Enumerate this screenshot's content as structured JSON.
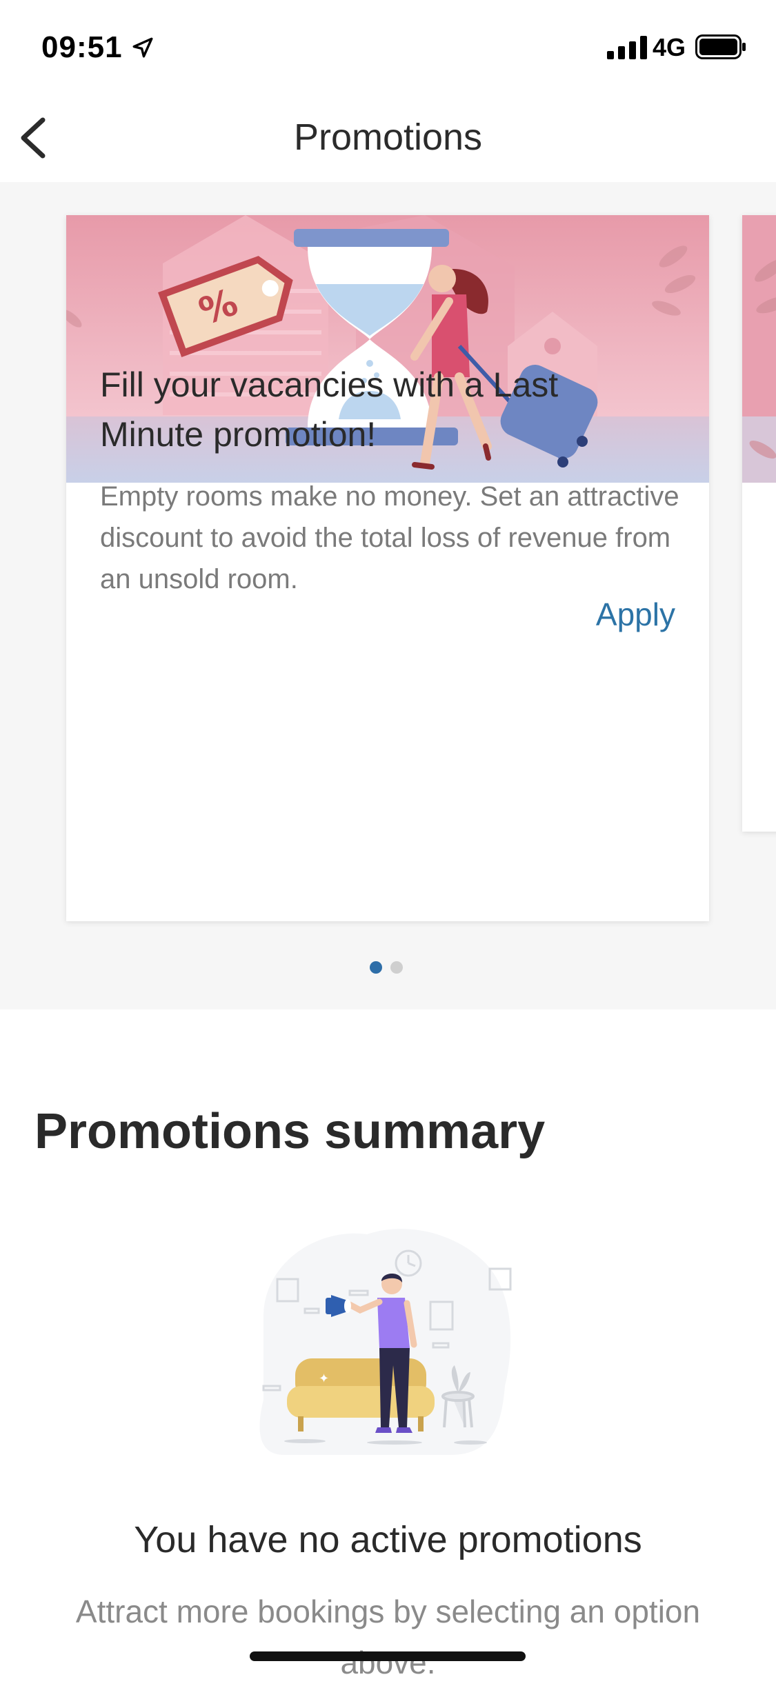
{
  "status_bar": {
    "time": "09:51",
    "network": "4G"
  },
  "nav": {
    "title": "Promotions"
  },
  "carousel": {
    "card": {
      "title": "Fill your vacancies with a Last Minute promotion!",
      "description": "Empty rooms make no money. Set an attractive discount to avoid the total loss of revenue from an unsold room.",
      "action_label": "Apply"
    },
    "page_count": 2,
    "active_page": 1,
    "accent_color": "#2c73a6"
  },
  "summary": {
    "title": "Promotions summary",
    "empty_title": "You have no active promotions",
    "empty_description": "Attract more bookings by selecting an option above."
  },
  "icons": [
    "location-arrow-icon",
    "cellular-signal-icon",
    "battery-icon",
    "back-chevron-icon"
  ]
}
